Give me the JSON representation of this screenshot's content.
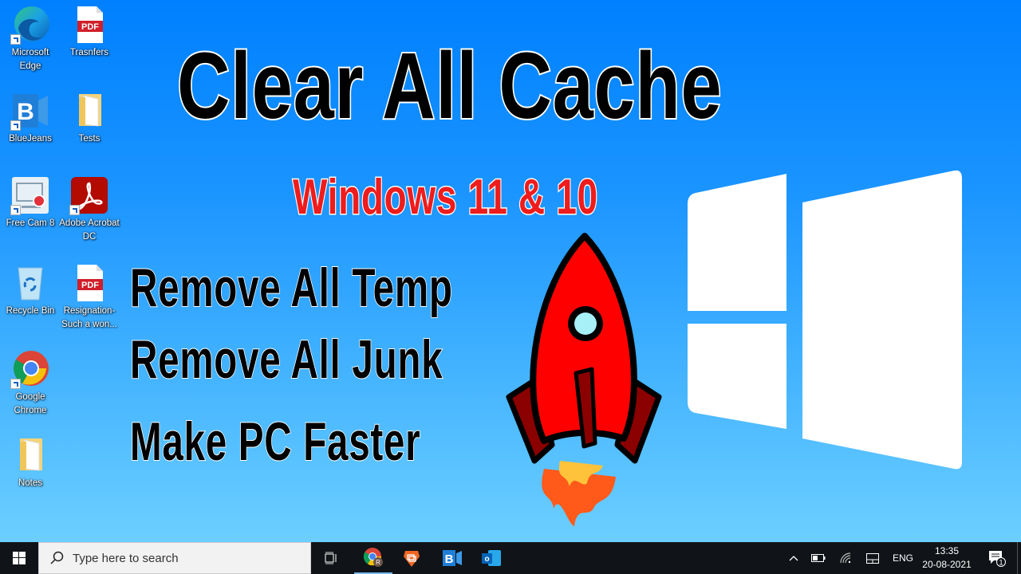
{
  "desktop": {
    "icons": [
      {
        "label": "Microsoft Edge",
        "icon": "edge-icon"
      },
      {
        "label": "Trasnfers",
        "icon": "pdf-file-icon"
      },
      {
        "label": "BlueJeans",
        "icon": "bluejeans-icon"
      },
      {
        "label": "Tests",
        "icon": "folder-icon"
      },
      {
        "label": "Free Cam 8",
        "icon": "freecam-icon"
      },
      {
        "label": "Adobe Acrobat DC",
        "icon": "acrobat-icon"
      },
      {
        "label": "Recycle Bin",
        "icon": "recycle-bin-icon"
      },
      {
        "label": "Resignation- Such a won...",
        "icon": "pdf-file-icon"
      },
      {
        "label": "Google Chrome",
        "icon": "chrome-icon"
      },
      {
        "label": "Notes",
        "icon": "folder-icon"
      }
    ],
    "pdf_badge": "PDF"
  },
  "overlay": {
    "title": "Clear All Cache",
    "subtitle": "Windows 11 & 10",
    "lines": [
      "Remove All Temp",
      "Remove All Junk",
      "Make PC Faster"
    ],
    "colors": {
      "title": "#000000",
      "subtitle": "#ee1c1c",
      "outline": "#ffffff",
      "rocket_body": "#ff0000",
      "rocket_fins": "#8b0000",
      "flame_outer": "#ff5a1a",
      "flame_inner": "#ffc23a"
    }
  },
  "taskbar": {
    "search_placeholder": "Type here to search",
    "pinned": [
      {
        "name": "task-view",
        "icon": "task-view-icon"
      },
      {
        "name": "chrome",
        "icon": "chrome-icon",
        "badge": "R"
      },
      {
        "name": "brave",
        "icon": "brave-icon"
      },
      {
        "name": "bluejeans",
        "icon": "bluejeans-icon"
      },
      {
        "name": "outlook",
        "icon": "outlook-icon"
      }
    ],
    "tray": {
      "language": "ENG",
      "time": "13:35",
      "date": "20-08-2021",
      "notification_count": "1"
    }
  },
  "theme": {
    "bg_top": "#0080ff",
    "bg_bottom": "#6ccfff",
    "taskbar": "#101418"
  }
}
